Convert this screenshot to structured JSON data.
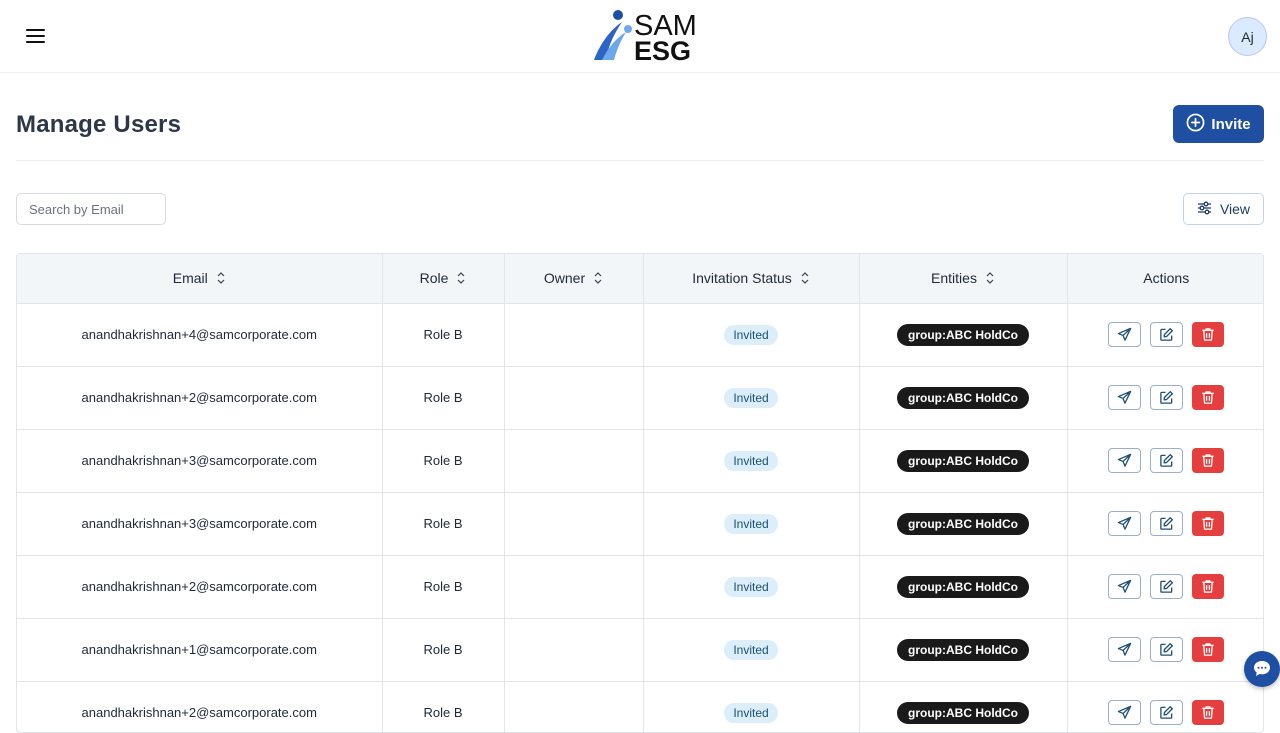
{
  "brand": {
    "logo_top": "SAM",
    "logo_bottom": "ESG"
  },
  "header": {
    "avatar_initials": "Aj"
  },
  "page": {
    "title": "Manage Users",
    "invite_label": "Invite",
    "search_placeholder": "Search by Email",
    "view_label": "View"
  },
  "table": {
    "columns": {
      "email": "Email",
      "role": "Role",
      "owner": "Owner",
      "status": "Invitation Status",
      "entities": "Entities",
      "actions": "Actions"
    },
    "rows": [
      {
        "email": "anandhakrishnan+4@samcorporate.com",
        "role": "Role B",
        "owner": "",
        "status": "Invited",
        "entity": "group:ABC HoldCo"
      },
      {
        "email": "anandhakrishnan+2@samcorporate.com",
        "role": "Role B",
        "owner": "",
        "status": "Invited",
        "entity": "group:ABC HoldCo"
      },
      {
        "email": "anandhakrishnan+3@samcorporate.com",
        "role": "Role B",
        "owner": "",
        "status": "Invited",
        "entity": "group:ABC HoldCo"
      },
      {
        "email": "anandhakrishnan+3@samcorporate.com",
        "role": "Role B",
        "owner": "",
        "status": "Invited",
        "entity": "group:ABC HoldCo"
      },
      {
        "email": "anandhakrishnan+2@samcorporate.com",
        "role": "Role B",
        "owner": "",
        "status": "Invited",
        "entity": "group:ABC HoldCo"
      },
      {
        "email": "anandhakrishnan+1@samcorporate.com",
        "role": "Role B",
        "owner": "",
        "status": "Invited",
        "entity": "group:ABC HoldCo"
      },
      {
        "email": "anandhakrishnan+2@samcorporate.com",
        "role": "Role B",
        "owner": "",
        "status": "Invited",
        "entity": "group:ABC HoldCo"
      }
    ]
  },
  "colors": {
    "primary": "#1f4fa3",
    "danger": "#e53e3e",
    "status_bg": "#dbeefa",
    "entity_bg": "#1a1a1a"
  },
  "icons": [
    "menu-icon",
    "plus-circle-icon",
    "sliders-icon",
    "sort-icon",
    "send-icon",
    "edit-icon",
    "trash-icon",
    "chat-icon"
  ]
}
